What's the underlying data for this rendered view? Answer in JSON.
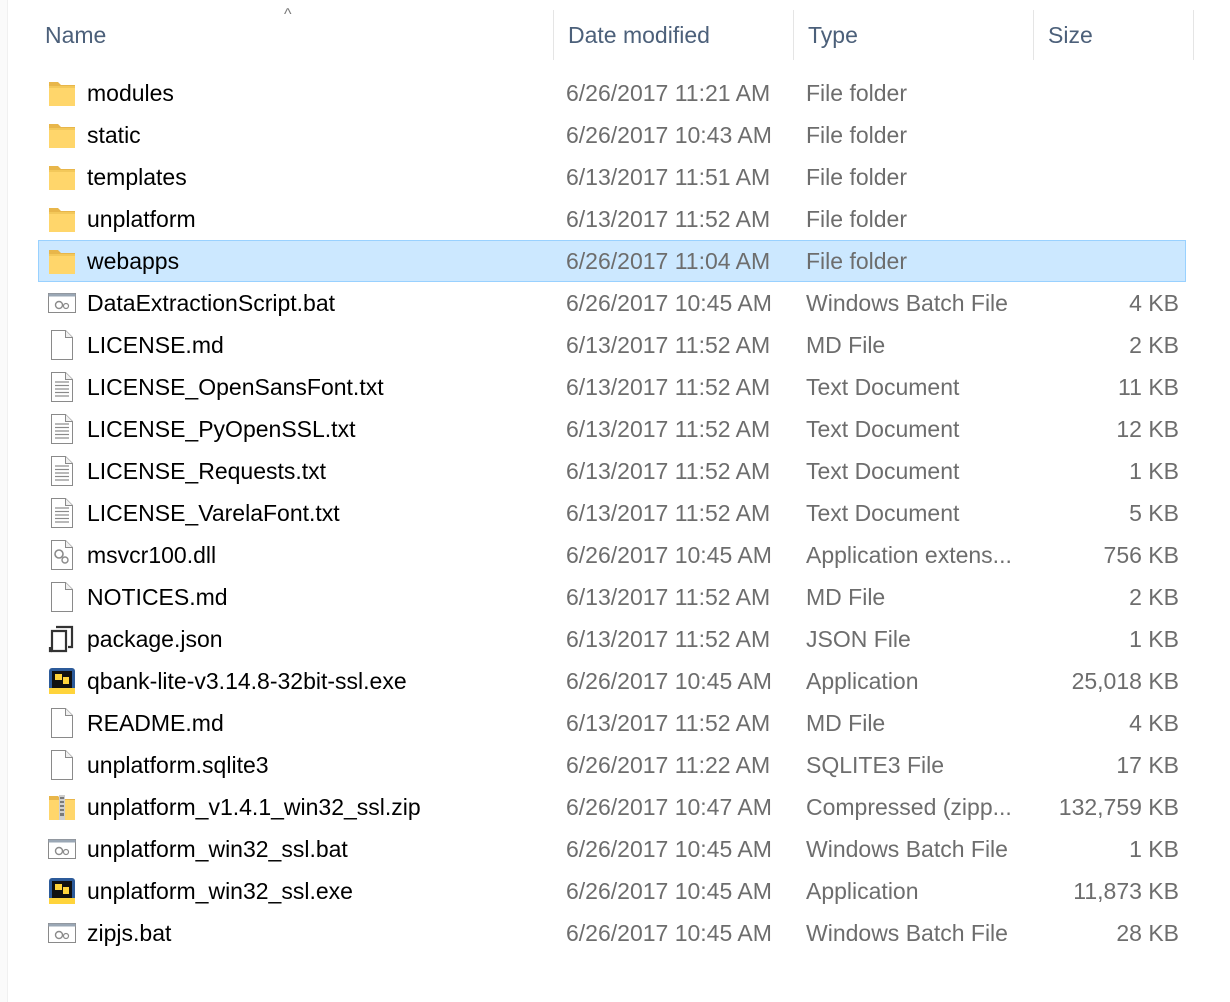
{
  "columns": {
    "name": "Name",
    "date": "Date modified",
    "type": "Type",
    "size": "Size"
  },
  "sort": {
    "column": "name",
    "direction": "ascending",
    "arrow": "^"
  },
  "colors": {
    "selection_bg": "#cce8ff",
    "selection_border": "#99d1ff",
    "folder": "#ffd66b",
    "header_text": "#4c607a",
    "detail_text": "#6d6d6d"
  },
  "files": [
    {
      "name": "modules",
      "date": "6/26/2017 11:21 AM",
      "type": "File folder",
      "size": "",
      "icon": "folder-icon",
      "selected": false
    },
    {
      "name": "static",
      "date": "6/26/2017 10:43 AM",
      "type": "File folder",
      "size": "",
      "icon": "folder-icon",
      "selected": false
    },
    {
      "name": "templates",
      "date": "6/13/2017 11:51 AM",
      "type": "File folder",
      "size": "",
      "icon": "folder-icon",
      "selected": false
    },
    {
      "name": "unplatform",
      "date": "6/13/2017 11:52 AM",
      "type": "File folder",
      "size": "",
      "icon": "folder-icon",
      "selected": false
    },
    {
      "name": "webapps",
      "date": "6/26/2017 11:04 AM",
      "type": "File folder",
      "size": "",
      "icon": "folder-icon",
      "selected": true
    },
    {
      "name": "DataExtractionScript.bat",
      "date": "6/26/2017 10:45 AM",
      "type": "Windows Batch File",
      "size": "4 KB",
      "icon": "batch-file-icon",
      "selected": false
    },
    {
      "name": "LICENSE.md",
      "date": "6/13/2017 11:52 AM",
      "type": "MD File",
      "size": "2 KB",
      "icon": "blank-file-icon",
      "selected": false
    },
    {
      "name": "LICENSE_OpenSansFont.txt",
      "date": "6/13/2017 11:52 AM",
      "type": "Text Document",
      "size": "11 KB",
      "icon": "text-file-icon",
      "selected": false
    },
    {
      "name": "LICENSE_PyOpenSSL.txt",
      "date": "6/13/2017 11:52 AM",
      "type": "Text Document",
      "size": "12 KB",
      "icon": "text-file-icon",
      "selected": false
    },
    {
      "name": "LICENSE_Requests.txt",
      "date": "6/13/2017 11:52 AM",
      "type": "Text Document",
      "size": "1 KB",
      "icon": "text-file-icon",
      "selected": false
    },
    {
      "name": "LICENSE_VarelaFont.txt",
      "date": "6/13/2017 11:52 AM",
      "type": "Text Document",
      "size": "5 KB",
      "icon": "text-file-icon",
      "selected": false
    },
    {
      "name": "msvcr100.dll",
      "date": "6/26/2017 10:45 AM",
      "type": "Application extens...",
      "size": "756 KB",
      "icon": "dll-file-icon",
      "selected": false
    },
    {
      "name": "NOTICES.md",
      "date": "6/13/2017 11:52 AM",
      "type": "MD File",
      "size": "2 KB",
      "icon": "blank-file-icon",
      "selected": false
    },
    {
      "name": "package.json",
      "date": "6/13/2017 11:52 AM",
      "type": "JSON File",
      "size": "1 KB",
      "icon": "json-file-icon",
      "selected": false
    },
    {
      "name": "qbank-lite-v3.14.8-32bit-ssl.exe",
      "date": "6/26/2017 10:45 AM",
      "type": "Application",
      "size": "25,018 KB",
      "icon": "python-exe-icon",
      "selected": false
    },
    {
      "name": "README.md",
      "date": "6/13/2017 11:52 AM",
      "type": "MD File",
      "size": "4 KB",
      "icon": "blank-file-icon",
      "selected": false
    },
    {
      "name": "unplatform.sqlite3",
      "date": "6/26/2017 11:22 AM",
      "type": "SQLITE3 File",
      "size": "17 KB",
      "icon": "blank-file-icon",
      "selected": false
    },
    {
      "name": "unplatform_v1.4.1_win32_ssl.zip",
      "date": "6/26/2017 10:47 AM",
      "type": "Compressed (zipp...",
      "size": "132,759 KB",
      "icon": "zip-folder-icon",
      "selected": false
    },
    {
      "name": "unplatform_win32_ssl.bat",
      "date": "6/26/2017 10:45 AM",
      "type": "Windows Batch File",
      "size": "1 KB",
      "icon": "batch-file-icon",
      "selected": false
    },
    {
      "name": "unplatform_win32_ssl.exe",
      "date": "6/26/2017 10:45 AM",
      "type": "Application",
      "size": "11,873 KB",
      "icon": "python-exe-icon",
      "selected": false
    },
    {
      "name": "zipjs.bat",
      "date": "6/26/2017 10:45 AM",
      "type": "Windows Batch File",
      "size": "28 KB",
      "icon": "batch-file-icon",
      "selected": false
    }
  ]
}
